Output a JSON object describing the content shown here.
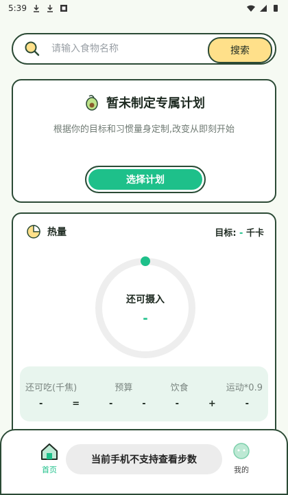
{
  "status_bar": {
    "time": "5:39"
  },
  "search": {
    "placeholder": "请输入食物名称",
    "button_label": "搜索"
  },
  "plan_card": {
    "title": "暂未制定专属计划",
    "description": "根据你的目标和习惯量身定制,改变从即刻开始",
    "button_label": "选择计划"
  },
  "calorie_card": {
    "title": "热量",
    "goal_label": "目标:",
    "goal_value": "-",
    "goal_unit": "千卡",
    "ring_label": "还可摄入",
    "ring_value": "-",
    "stats_labels": [
      "还可吃(千焦)",
      "预算",
      "饮食",
      "运动*0.9"
    ],
    "stats_values": [
      "-",
      "=",
      "-",
      "-",
      "-",
      "+",
      "-"
    ]
  },
  "bottom_nav": {
    "home_label": "首页",
    "mine_label": "我的"
  },
  "toast": {
    "text": "当前手机不支持查看步数"
  },
  "colors": {
    "accent": "#1ec08a",
    "search_button": "#ffe08a",
    "border": "#2b4a35",
    "stats_bg": "#e8f5ee"
  }
}
